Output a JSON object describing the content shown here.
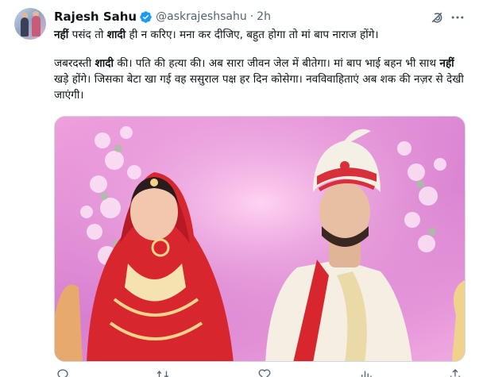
{
  "author": {
    "name": "Rajesh Sahu",
    "handle": "@askrajeshsahu",
    "separator": "·",
    "time": "2h",
    "verified": true,
    "verified_color": "#1d9bf0"
  },
  "icons": {
    "avatar": "avatar-image",
    "verified": "verified-badge-icon",
    "grok": "grok-icon",
    "more": "more-options-icon",
    "reply": "reply-icon",
    "retweet": "retweet-icon",
    "like": "like-icon",
    "views": "views-icon",
    "share": "share-icon"
  },
  "tweet": {
    "line1": {
      "w1": "नहीं",
      "t1": " पसंद तो ",
      "w2": "शादी",
      "t2": " ही न करिए। मना कर दीजिए, बहुत होगा तो मां बाप नाराज होंगे।"
    },
    "para2": {
      "t1": "जबरदस्ती ",
      "w1": "शादी",
      "t2": " की। पति की हत्या की। अब सारा जीवन जेल में बीतेगा। मां बाप भाई बहन भी साथ ",
      "w2": "नहीं",
      "t3": " खड़े होंगे। जिसका बेटा खा गई वह ससुराल पक्ष हर दिन कोसेगा। नवविवाहिताएं अब शक की नज़र से देखी जाएंगी।"
    }
  },
  "media": {
    "type": "photo",
    "description_name": "wedding-couple-photo",
    "colors": {
      "backdrop": "#e58fd6",
      "bride_outfit": "#d8262f",
      "groom_sherwani": "#f4efe2",
      "groom_turban": "#f5f0e6",
      "turban_band": "#d8303a"
    }
  }
}
